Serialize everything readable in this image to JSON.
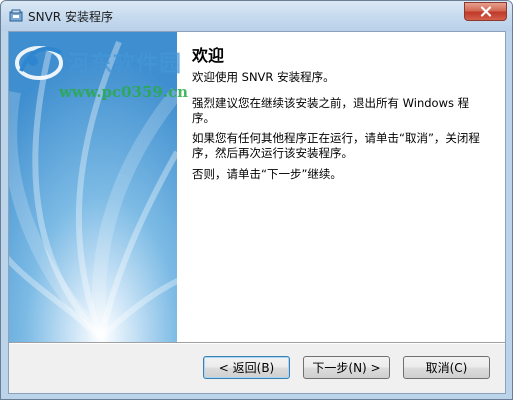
{
  "window": {
    "title": "SNVR 安装程序"
  },
  "watermark": {
    "title": "河东软件园",
    "url": "www.pc0359.cn"
  },
  "welcome": {
    "heading": "欢迎",
    "intro": "欢迎使用 SNVR  安装程序。",
    "advice": "强烈建议您在继续该安装之前，退出所有 Windows 程序。",
    "running_note": "如果您有任何其他程序正在运行，请单击“取消”，关闭程序，然后再次运行该安装程序。",
    "continue_note": "否则，请单击“下一步”继续。"
  },
  "buttons": {
    "back": "< 返回(B)",
    "next": "下一步(N) >",
    "cancel": "取消(C)"
  },
  "colors": {
    "title_bar": "#c4d9ee",
    "close_button": "#c0392b",
    "side_panel": "#5aa6d8"
  }
}
